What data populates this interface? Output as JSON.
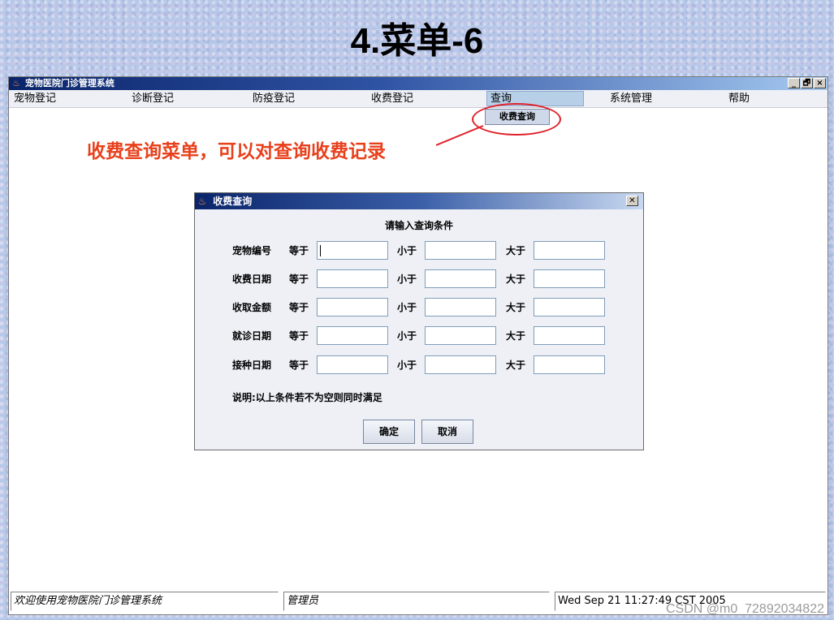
{
  "slide": {
    "title": "4.菜单-6"
  },
  "window": {
    "title": "宠物医院门诊管理系统",
    "controls": [
      "_",
      "🗗",
      "×"
    ]
  },
  "menubar": {
    "items": [
      "宠物登记",
      "诊断登记",
      "防疫登记",
      "收费登记",
      "查询",
      "系统管理",
      "帮助"
    ]
  },
  "dropdown": {
    "items": [
      "收费查询"
    ]
  },
  "annotation": "收费查询菜单，可以对查询收费记录",
  "dialog": {
    "title": "收费查询",
    "heading": "请输入查询条件",
    "rows": [
      {
        "label": "宠物编号",
        "eq": "等于",
        "lt": "小于",
        "gt": "大于"
      },
      {
        "label": "收费日期",
        "eq": "等于",
        "lt": "小于",
        "gt": "大于"
      },
      {
        "label": "收取金额",
        "eq": "等于",
        "lt": "小于",
        "gt": "大于"
      },
      {
        "label": "就诊日期",
        "eq": "等于",
        "lt": "小于",
        "gt": "大于"
      },
      {
        "label": "接种日期",
        "eq": "等于",
        "lt": "小于",
        "gt": "大于"
      }
    ],
    "note": "说明:以上条件若不为空则同时满足",
    "ok_label": "确定",
    "cancel_label": "取消"
  },
  "status": {
    "welcome": "欢迎使用宠物医院门诊管理系统",
    "user": "管理员",
    "datetime": "Wed Sep 21 11:27:49 CST 2005"
  },
  "watermark": "CSDN @m0_72892034822",
  "colors": {
    "annotation": "#e8401c",
    "callout": "#e0202a",
    "titlebar": "#0a246a"
  }
}
